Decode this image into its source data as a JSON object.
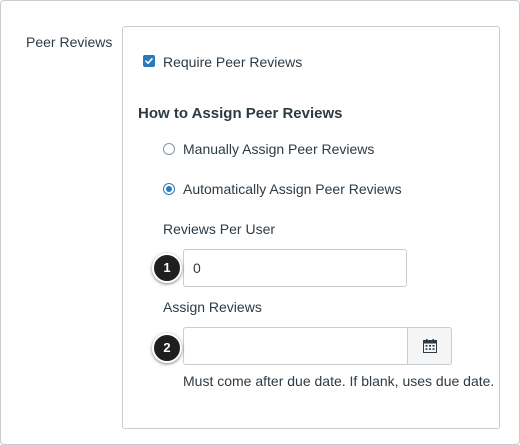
{
  "section": {
    "label": "Peer Reviews"
  },
  "require_checkbox": {
    "label": "Require Peer Reviews",
    "checked": true
  },
  "assign_section": {
    "heading": "How to Assign Peer Reviews",
    "options": [
      {
        "label": "Manually Assign Peer Reviews",
        "selected": false
      },
      {
        "label": "Automatically Assign Peer Reviews",
        "selected": true
      }
    ]
  },
  "reviews_per_user": {
    "label": "Reviews Per User",
    "value": "0"
  },
  "assign_reviews": {
    "label": "Assign Reviews",
    "value": "",
    "hint": "Must come after due date. If blank, uses due date."
  },
  "callouts": [
    "1",
    "2"
  ],
  "colors": {
    "accent": "#2b7abc",
    "text": "#2d3b45",
    "border": "#c7cdd1",
    "callout_bg": "#1f1f1f"
  },
  "icons": {
    "checkbox": "checkmark-icon",
    "calendar": "calendar-icon"
  }
}
